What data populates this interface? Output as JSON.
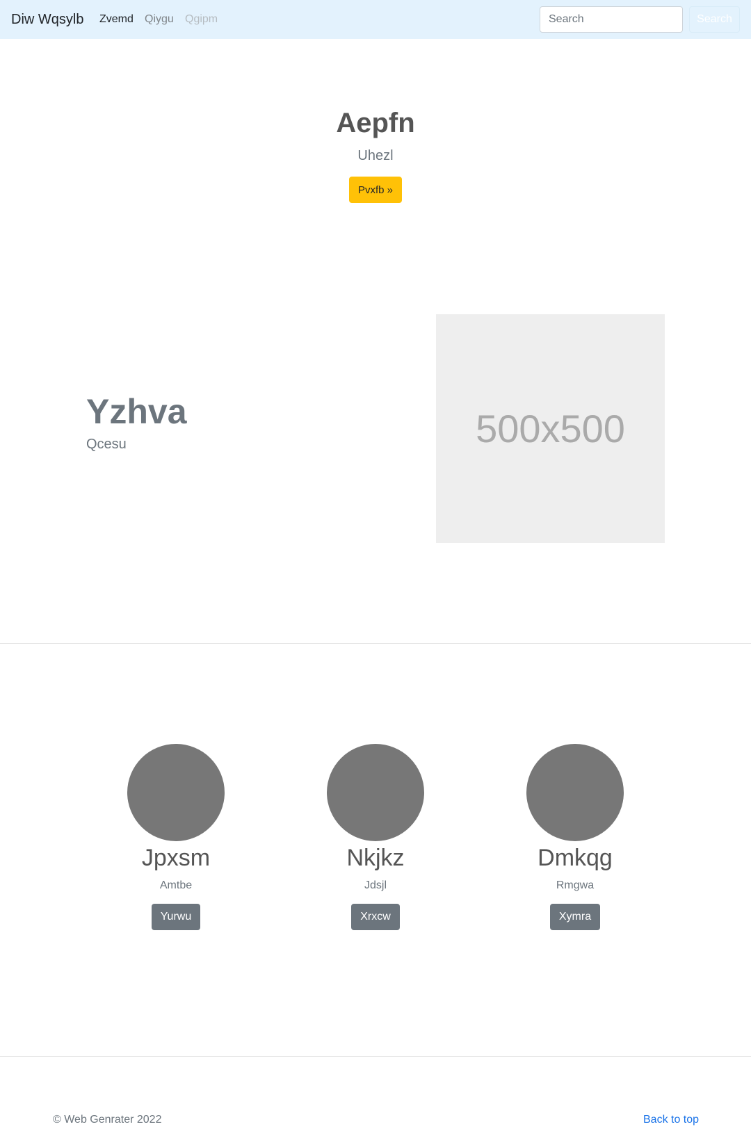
{
  "navbar": {
    "brand": "Diw Wqsylb",
    "links": [
      {
        "label": "Zvemd",
        "state": "active"
      },
      {
        "label": "Qiygu",
        "state": "normal"
      },
      {
        "label": "Qgipm",
        "state": "disabled"
      }
    ],
    "search": {
      "placeholder": "Search",
      "button_label": "Search"
    }
  },
  "hero": {
    "title": "Aepfn",
    "subtitle": "Uhezl",
    "button_label": "Pvxfb »",
    "button_color": "#ffc107"
  },
  "feature": {
    "heading": "Yzhva",
    "text": "Qcesu",
    "image_label": "500x500"
  },
  "team": [
    {
      "name": "Jpxsm",
      "role": "Amtbe",
      "button_label": "Yurwu"
    },
    {
      "name": "Nkjkz",
      "role": "Jdsjl",
      "button_label": "Xrxcw"
    },
    {
      "name": "Dmkqg",
      "role": "Rmgwa",
      "button_label": "Xymra"
    }
  ],
  "footer": {
    "copyright": "© Web Genrater 2022",
    "back_to_top": "Back to top"
  },
  "colors": {
    "navbar_bg": "#e3f2fd",
    "link_color": "#1a73e8",
    "team_button_bg": "#6c757d"
  }
}
